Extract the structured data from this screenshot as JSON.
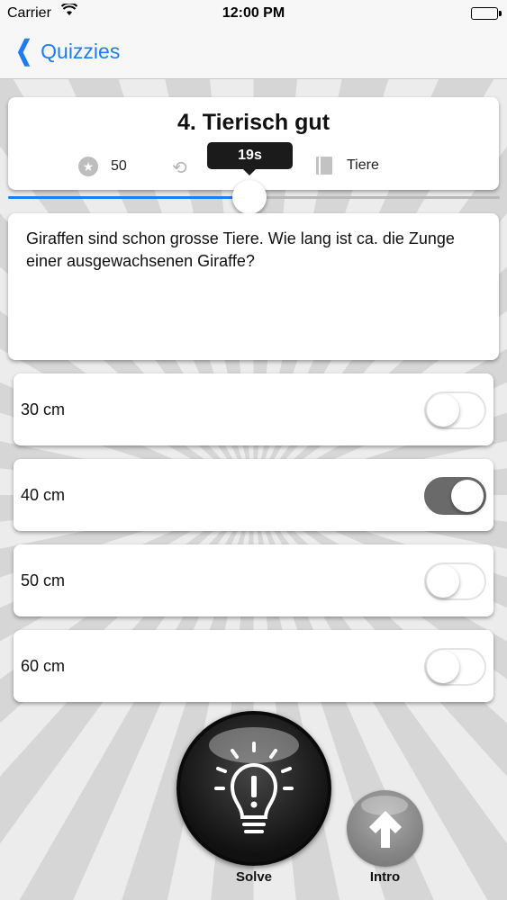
{
  "status_bar": {
    "carrier": "Carrier",
    "wifi_icon": "wifi-icon",
    "time": "12:00 PM",
    "battery_icon": "battery-icon"
  },
  "nav": {
    "back_label": "Quizzies",
    "back_icon": "chevron-left-icon"
  },
  "quiz": {
    "title": "4. Tierisch gut",
    "points": "50",
    "points_icon": "star-icon",
    "time_icon": "history-icon",
    "category": "Tiere",
    "category_icon": "book-icon"
  },
  "timer": {
    "tooltip": "19s",
    "progress_fraction": 0.49
  },
  "question": {
    "text": "Giraffen sind schon grosse Tiere. Wie lang ist ca. die Zunge einer ausgewachsenen Giraffe?"
  },
  "answers": [
    {
      "label": "30 cm",
      "selected": false
    },
    {
      "label": "40 cm",
      "selected": true
    },
    {
      "label": "50 cm",
      "selected": false
    },
    {
      "label": "60 cm",
      "selected": false
    }
  ],
  "actions": {
    "solve_label": "Solve",
    "solve_icon": "lightbulb-icon",
    "intro_label": "Intro",
    "intro_icon": "arrow-up-icon"
  },
  "colors": {
    "accent": "#1f7cf2",
    "toggle_on": "#6a6a6a"
  }
}
